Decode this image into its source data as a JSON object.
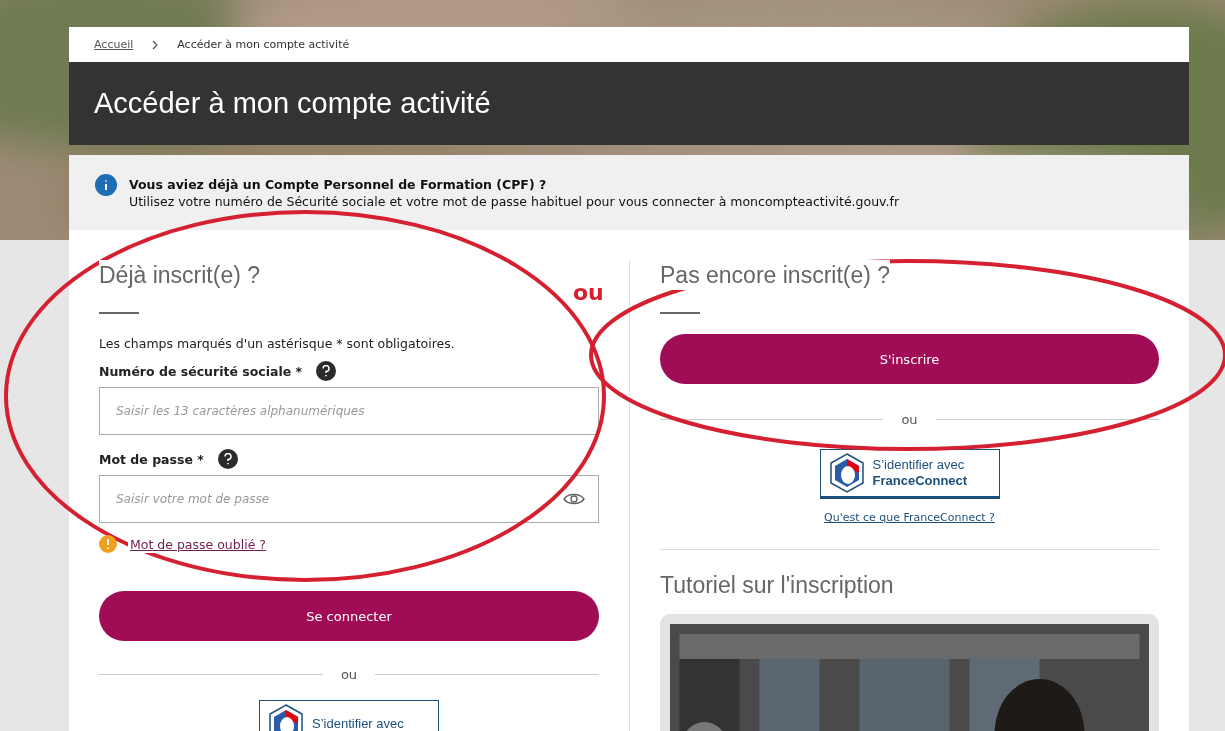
{
  "breadcrumb": [
    {
      "label": "Accueil",
      "link": true
    },
    {
      "label": "Accéder à mon compte activité",
      "link": false
    }
  ],
  "page_title": "Accéder à mon compte activité",
  "info": {
    "title": "Vous aviez déjà un Compte Personnel de Formation (CPF) ?",
    "text": "Utilisez votre numéro de Sécurité sociale et votre mot de passe habituel pour vous connecter à moncompteactivité.gouv.fr"
  },
  "login": {
    "title": "Déjà inscrit(e) ?",
    "required_note": "Les champs marqués d'un astérisque * sont obligatoires.",
    "fields": [
      {
        "label": "Numéro de sécurité sociale *",
        "placeholder": "Saisir les 13 caractères alphanumériques",
        "kind": "text"
      },
      {
        "label": "Mot de passe *",
        "placeholder": "Saisir votre mot de passe",
        "kind": "password"
      }
    ],
    "forgot_link": "Mot de passe oublié ?",
    "submit": "Se connecter",
    "separator": "ou",
    "franceconnect": [
      "S’identifier avec"
    ]
  },
  "signup": {
    "title": "Pas encore inscrit(e) ?",
    "button": "S'inscrire",
    "separator": "ou",
    "franceconnect": [
      "S’identifier avec",
      "FranceConnect"
    ],
    "franceconnect_help": "Qu'est ce que FranceConnect ?"
  },
  "tutorial": {
    "title": "Tutoriel sur l'inscription"
  },
  "annotation": {
    "label": "ou"
  }
}
